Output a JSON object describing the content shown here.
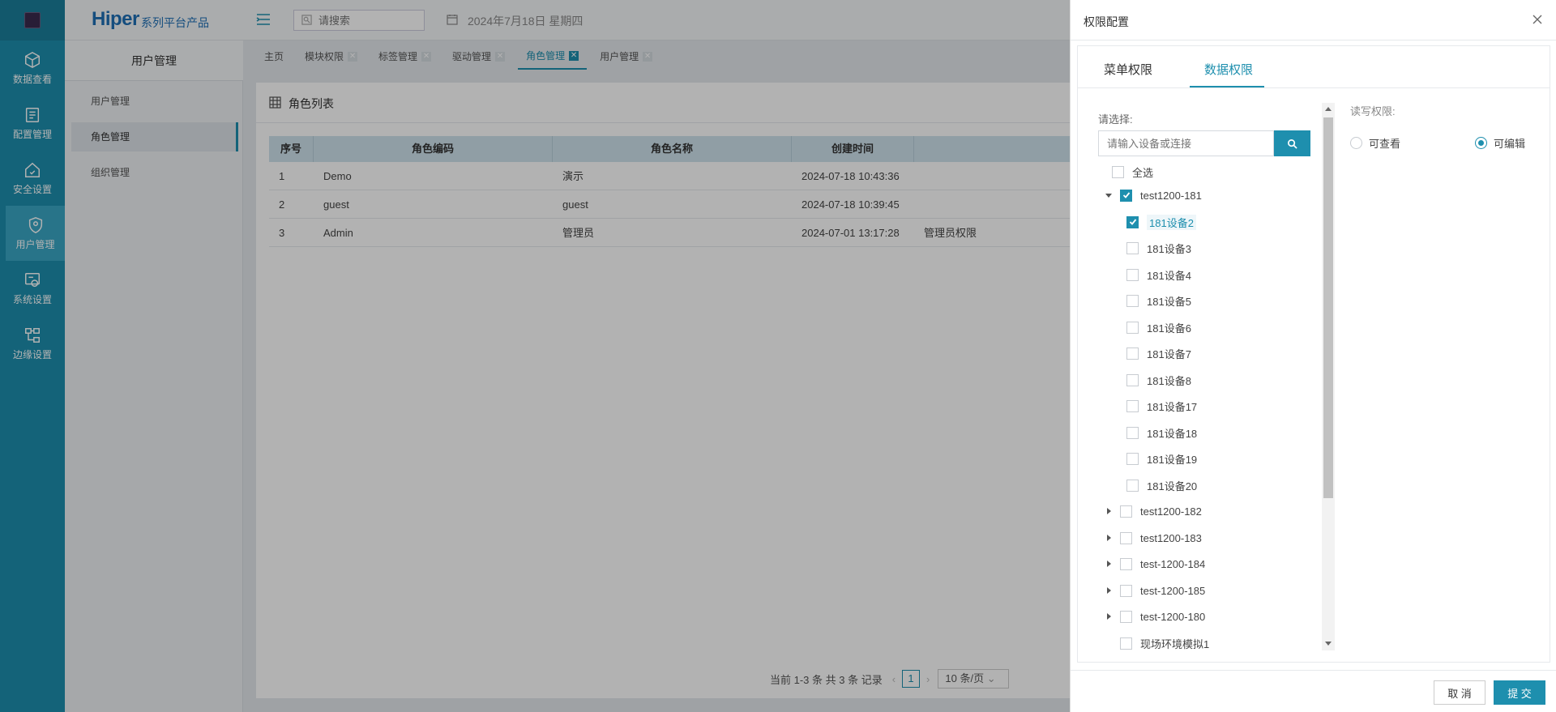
{
  "nav": {
    "items": [
      {
        "label": "数据查看",
        "icon": "cube-icon"
      },
      {
        "label": "配置管理",
        "icon": "config-icon"
      },
      {
        "label": "安全设置",
        "icon": "home-shield-icon"
      },
      {
        "label": "用户管理",
        "icon": "user-shield-icon",
        "active": true
      },
      {
        "label": "系统设置",
        "icon": "system-icon"
      },
      {
        "label": "边缘设置",
        "icon": "edge-icon"
      }
    ]
  },
  "header": {
    "brand": "Hiper",
    "brand_sub": "系列平台产品",
    "search_placeholder": "请搜索",
    "date": "2024年7月18日 星期四"
  },
  "subside": {
    "title": "用户管理",
    "items": [
      "用户管理",
      "角色管理",
      "组织管理"
    ],
    "active_index": 1
  },
  "tabs": [
    {
      "label": "主页",
      "closable": false
    },
    {
      "label": "模块权限",
      "closable": true
    },
    {
      "label": "标签管理",
      "closable": true
    },
    {
      "label": "驱动管理",
      "closable": true
    },
    {
      "label": "角色管理",
      "closable": true,
      "active": true
    },
    {
      "label": "用户管理",
      "closable": true
    }
  ],
  "panel": {
    "title": "角色列表",
    "columns": [
      "序号",
      "角色编码",
      "角色名称",
      "创建时间",
      ""
    ],
    "rows": [
      [
        "1",
        "Demo",
        "演示",
        "2024-07-18 10:43:36",
        ""
      ],
      [
        "2",
        "guest",
        "guest",
        "2024-07-18 10:39:45",
        ""
      ],
      [
        "3",
        "Admin",
        "管理员",
        "2024-07-01 13:17:28",
        "管理员权限"
      ]
    ],
    "pager": {
      "summary": "当前 1-3 条 共 3 条 记录",
      "page": "1",
      "size": "10 条/页"
    }
  },
  "drawer": {
    "title": "权限配置",
    "tabs": [
      "菜单权限",
      "数据权限"
    ],
    "active_tab": 1,
    "select_label": "请选择:",
    "search_placeholder": "请输入设备或连接",
    "select_all": "全选",
    "tree": [
      {
        "label": "test1200-181",
        "level": 0,
        "expanded": true,
        "checked": true
      },
      {
        "label": "181设备2",
        "level": 1,
        "checked": true,
        "highlight": true
      },
      {
        "label": "181设备3",
        "level": 1,
        "checked": false
      },
      {
        "label": "181设备4",
        "level": 1,
        "checked": false
      },
      {
        "label": "181设备5",
        "level": 1,
        "checked": false
      },
      {
        "label": "181设备6",
        "level": 1,
        "checked": false
      },
      {
        "label": "181设备7",
        "level": 1,
        "checked": false
      },
      {
        "label": "181设备8",
        "level": 1,
        "checked": false
      },
      {
        "label": "181设备17",
        "level": 1,
        "checked": false
      },
      {
        "label": "181设备18",
        "level": 1,
        "checked": false
      },
      {
        "label": "181设备19",
        "level": 1,
        "checked": false
      },
      {
        "label": "181设备20",
        "level": 1,
        "checked": false
      },
      {
        "label": "test1200-182",
        "level": 0,
        "expanded": false,
        "checked": false
      },
      {
        "label": "test1200-183",
        "level": 0,
        "expanded": false,
        "checked": false
      },
      {
        "label": "test-1200-184",
        "level": 0,
        "expanded": false,
        "checked": false
      },
      {
        "label": "test-1200-185",
        "level": 0,
        "expanded": false,
        "checked": false
      },
      {
        "label": "test-1200-180",
        "level": 0,
        "expanded": false,
        "checked": false
      },
      {
        "label": "现场环境模拟1",
        "level": 0,
        "leaf": true,
        "checked": false
      }
    ],
    "rw_label": "读写权限:",
    "radios": [
      {
        "label": "可查看",
        "checked": false
      },
      {
        "label": "可编辑",
        "checked": true
      }
    ],
    "cancel": "取 消",
    "submit": "提 交"
  },
  "colors": {
    "accent": "#1e8fae",
    "nav_bg": "#1e8fae"
  }
}
